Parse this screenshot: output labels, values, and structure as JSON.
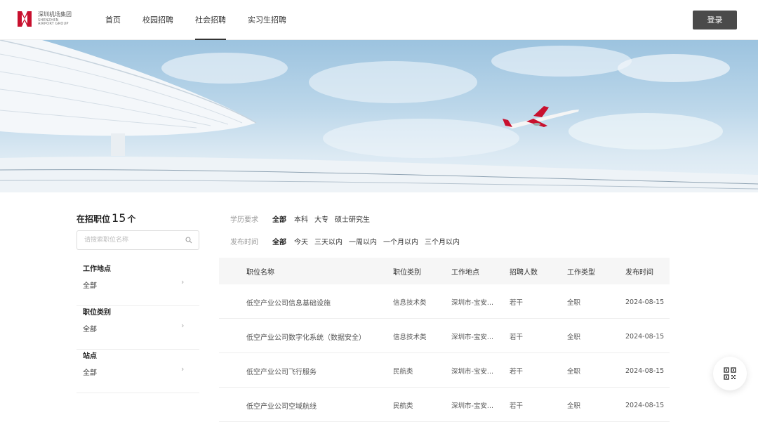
{
  "brand": {
    "name_cn": "深圳机场集团",
    "name_en_1": "SHENZHEN",
    "name_en_2": "AIRPORT GROUP",
    "color": "#c8102e"
  },
  "nav": [
    {
      "label": "首页",
      "active": false
    },
    {
      "label": "校园招聘",
      "active": false
    },
    {
      "label": "社会招聘",
      "active": true
    },
    {
      "label": "实习生招聘",
      "active": false
    }
  ],
  "login_label": "登录",
  "sidebar": {
    "title": "在招职位",
    "count": "15",
    "unit": "个",
    "search_placeholder": "请搜索职位名称",
    "groups": [
      {
        "label": "工作地点",
        "value": "全部"
      },
      {
        "label": "职位类别",
        "value": "全部"
      },
      {
        "label": "站点",
        "value": "全部"
      }
    ]
  },
  "filters": {
    "education": {
      "label": "学历要求",
      "options": [
        "全部",
        "本科",
        "大专",
        "硕士研究生"
      ],
      "selected": "全部"
    },
    "publish_time": {
      "label": "发布时间",
      "options": [
        "全部",
        "今天",
        "三天以内",
        "一周以内",
        "一个月以内",
        "三个月以内"
      ],
      "selected": "全部"
    }
  },
  "table": {
    "headers": [
      "职位名称",
      "职位类别",
      "工作地点",
      "招聘人数",
      "工作类型",
      "发布时间"
    ],
    "rows": [
      [
        "低空产业公司信息基础设施",
        "信息技术类",
        "深圳市-宝安...",
        "若干",
        "全职",
        "2024-08-15"
      ],
      [
        "低空产业公司数字化系统（数据安全）",
        "信息技术类",
        "深圳市-宝安...",
        "若干",
        "全职",
        "2024-08-15"
      ],
      [
        "低空产业公司飞行服务",
        "民航类",
        "深圳市-宝安...",
        "若干",
        "全职",
        "2024-08-15"
      ],
      [
        "低空产业公司空域航线",
        "民航类",
        "深圳市-宝安...",
        "若干",
        "全职",
        "2024-08-15"
      ]
    ]
  }
}
